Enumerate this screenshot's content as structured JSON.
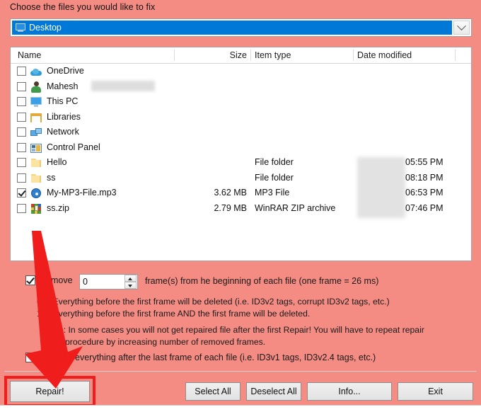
{
  "header": {
    "label": "Choose the files you would like to fix"
  },
  "path_combo": {
    "value": "Desktop",
    "icon": "desktop-icon",
    "dropdown_icon": "chevron-down-icon"
  },
  "file_list": {
    "columns": [
      "Name",
      "Size",
      "Item type",
      "Date modified"
    ],
    "rows": [
      {
        "checked": false,
        "icon": "onedrive-icon",
        "name": "OneDrive",
        "size": "",
        "type": "",
        "date": ""
      },
      {
        "checked": false,
        "icon": "user-account-icon",
        "name": "Mahesh",
        "size": "",
        "type": "",
        "date": ""
      },
      {
        "checked": false,
        "icon": "this-pc-icon",
        "name": "This PC",
        "size": "",
        "type": "",
        "date": ""
      },
      {
        "checked": false,
        "icon": "libraries-icon",
        "name": "Libraries",
        "size": "",
        "type": "",
        "date": ""
      },
      {
        "checked": false,
        "icon": "network-icon",
        "name": "Network",
        "size": "",
        "type": "",
        "date": ""
      },
      {
        "checked": false,
        "icon": "control-panel-icon",
        "name": "Control Panel",
        "size": "",
        "type": "",
        "date": ""
      },
      {
        "checked": false,
        "icon": "folder-icon",
        "name": "Hello",
        "size": "",
        "type": "File folder",
        "date": "05:55 PM"
      },
      {
        "checked": false,
        "icon": "folder-icon",
        "name": "ss",
        "size": "",
        "type": "File folder",
        "date": "08:18 PM"
      },
      {
        "checked": true,
        "icon": "mp3-file-icon",
        "name": "My-MP3-File.mp3",
        "size": "3.62 MB",
        "type": "MP3 File",
        "date": "06:53 PM"
      },
      {
        "checked": false,
        "icon": "winrar-zip-icon",
        "name": "ss.zip",
        "size": "2.79 MB",
        "type": "WinRAR ZIP archive",
        "date": "07:46 PM"
      }
    ]
  },
  "options": {
    "remove_frames": {
      "checked": true,
      "label": "Remove",
      "value": "0",
      "suffix": "frame(s) from he beginning of each file (one frame = 26 ms)"
    },
    "legend": [
      {
        "key": "0",
        "text": "= Everything before the first frame will be deleted (i.e. ID3v2 tags, corrupt ID3v2 tags, etc.)"
      },
      {
        "key": "1",
        "text": "= Everything before the first frame AND the first frame will be deleted."
      }
    ],
    "note": [
      "Note: In some cases you will not get repaired file after the first Repair! You will have to repeat repair",
      "procedure by increasing number of removed frames."
    ],
    "remove_after": {
      "checked": false,
      "label": "Remove everything after the last frame of each file (i.e. ID3v1 tags, ID3v2.4 tags, etc.)"
    }
  },
  "buttons": {
    "repair": "Repair!",
    "select_all": "Select All",
    "deselect_all": "Deselect All",
    "info": "Info...",
    "exit": "Exit"
  },
  "annotation": {
    "arrow_color": "#f01d1d",
    "highlight_color": "#f01d1d",
    "target": "repair-button"
  },
  "colors": {
    "background": "#f48c84",
    "selection": "#0078d7",
    "panel": "#ffffff"
  }
}
